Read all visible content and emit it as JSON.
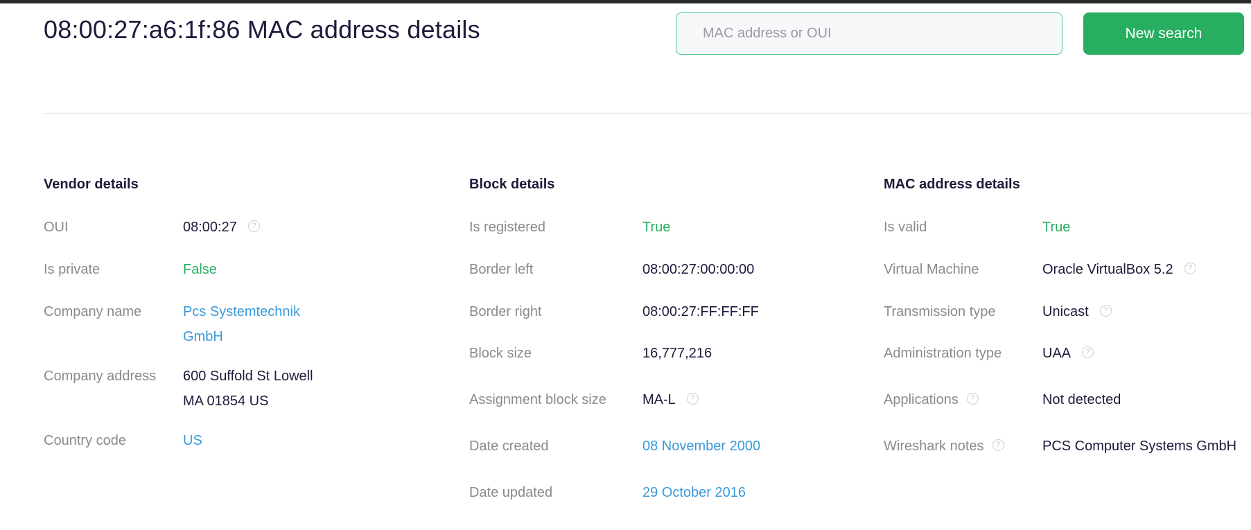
{
  "header": {
    "title": "08:00:27:a6:1f:86 MAC address details",
    "search_placeholder": "MAC address or OUI",
    "search_value": "",
    "new_search_label": "New search"
  },
  "vendor": {
    "heading": "Vendor details",
    "oui_label": "OUI",
    "oui_value": "08:00:27",
    "is_private_label": "Is private",
    "is_private_value": "False",
    "company_name_label": "Company name",
    "company_name_line1": "Pcs Systemtechnik",
    "company_name_line2": "GmbH",
    "company_address_label": "Company address",
    "company_address_line1": "600 Suffold St Lowell",
    "company_address_line2": "MA 01854 US",
    "country_code_label": "Country code",
    "country_code_value": "US"
  },
  "block": {
    "heading": "Block details",
    "is_registered_label": "Is registered",
    "is_registered_value": "True",
    "border_left_label": "Border left",
    "border_left_value": "08:00:27:00:00:00",
    "border_right_label": "Border right",
    "border_right_value": "08:00:27:FF:FF:FF",
    "block_size_label": "Block size",
    "block_size_value": "16,777,216",
    "assignment_label": "Assignment block size",
    "assignment_value": "MA-L",
    "date_created_label": "Date created",
    "date_created_value": "08 November 2000",
    "date_updated_label": "Date updated",
    "date_updated_value": "29 October 2016"
  },
  "mac": {
    "heading": "MAC address details",
    "is_valid_label": "Is valid",
    "is_valid_value": "True",
    "vm_label": "Virtual Machine",
    "vm_value": "Oracle VirtualBox 5.2",
    "transmission_label": "Transmission type",
    "transmission_value": "Unicast",
    "administration_label": "Administration type",
    "administration_value": "UAA",
    "applications_label": "Applications",
    "applications_value": "Not detected",
    "wireshark_label": "Wireshark notes",
    "wireshark_value": "PCS Computer Systems GmbH"
  },
  "icons": {
    "help": "question-circle-icon",
    "help_glyph": "?"
  },
  "colors": {
    "accent_green": "#27ae60",
    "link_blue": "#3a9ad9",
    "title_navy": "#1d1a3b",
    "label_gray": "#8a8a8f"
  }
}
